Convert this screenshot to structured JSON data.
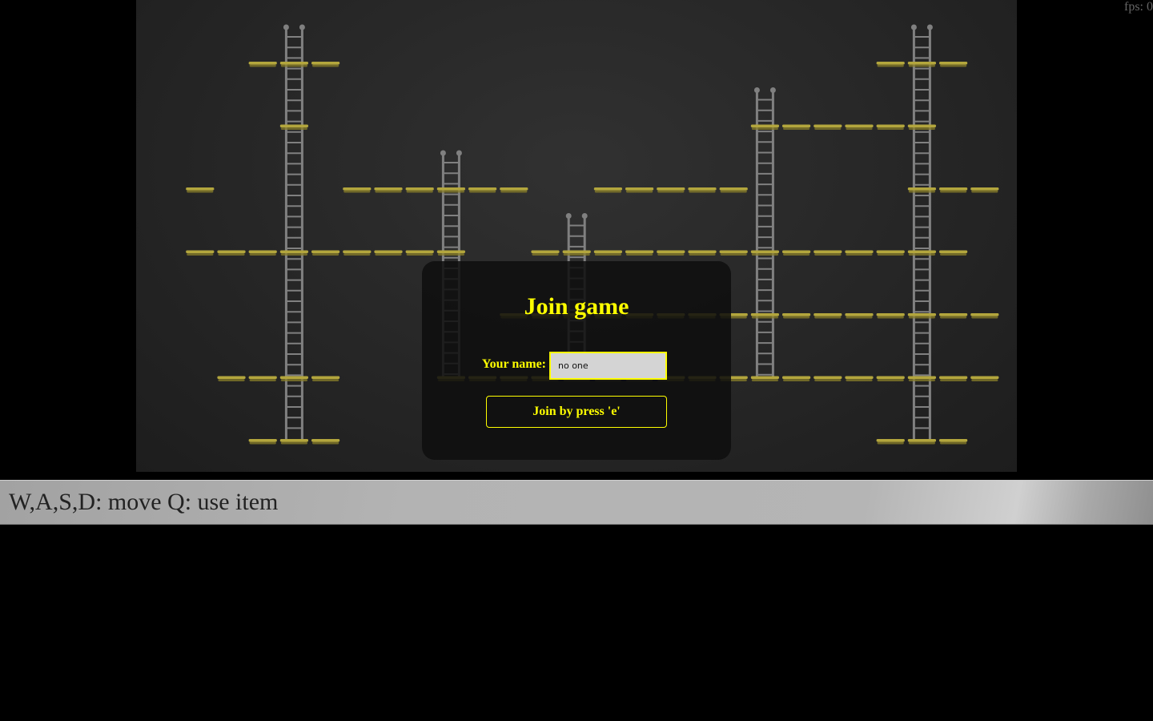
{
  "hud": {
    "fps_text": "fps: 0"
  },
  "join_dialog": {
    "title": "Join game",
    "name_label": "Your name:",
    "name_value": "no one",
    "join_button_label": "Join by press 'e'"
  },
  "help_bar": {
    "text": "W,A,S,D: move Q: use item"
  },
  "colors": {
    "accent": "#ffff00",
    "platform": "#8a7f2a",
    "ladder": "#808080",
    "background": "#000000"
  },
  "level": {
    "tile_columns": 28,
    "tile_rows": 7,
    "platform_rows": [
      {
        "row": 0,
        "columns": [
          3,
          4,
          5,
          23,
          24,
          25
        ]
      },
      {
        "row": 1,
        "columns": [
          4,
          19,
          20,
          21,
          22,
          23,
          24
        ]
      },
      {
        "row": 2,
        "columns": [
          1,
          6,
          7,
          8,
          9,
          10,
          11,
          14,
          15,
          16,
          17,
          18,
          24,
          25,
          26
        ]
      },
      {
        "row": 3,
        "columns": [
          1,
          2,
          3,
          4,
          5,
          6,
          7,
          8,
          9,
          12,
          13,
          14,
          15,
          16,
          17,
          18,
          19,
          20,
          21,
          22,
          23,
          24,
          25
        ]
      },
      {
        "row": 4,
        "columns": [
          11,
          12,
          13,
          14,
          15,
          16,
          17,
          18,
          19,
          20,
          21,
          22,
          23,
          24,
          25,
          26
        ]
      },
      {
        "row": 5,
        "columns": [
          2,
          3,
          4,
          5,
          9,
          10,
          11,
          12,
          13,
          14,
          15,
          16,
          17,
          18,
          19,
          20,
          21,
          22,
          23,
          24,
          25,
          26
        ]
      },
      {
        "row": 6,
        "columns": [
          3,
          4,
          5,
          23,
          24,
          25
        ]
      }
    ],
    "ladders": [
      {
        "column": 4,
        "top_row": 0,
        "bottom_row": 6
      },
      {
        "column": 9,
        "top_row": 2,
        "bottom_row": 5
      },
      {
        "column": 13,
        "top_row": 3,
        "bottom_row": 5
      },
      {
        "column": 19,
        "top_row": 1,
        "bottom_row": 5
      },
      {
        "column": 24,
        "top_row": 0,
        "bottom_row": 6
      }
    ]
  }
}
